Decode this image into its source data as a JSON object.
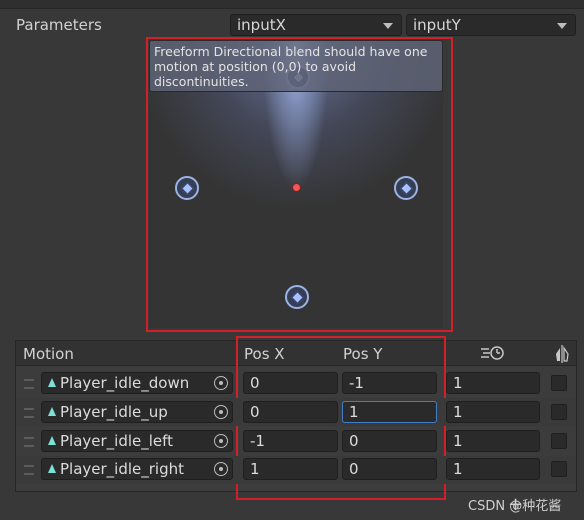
{
  "parameters": {
    "label": "Parameters",
    "param_x": "inputX",
    "param_y": "inputY"
  },
  "blend_tree": {
    "warning": "Freeform Directional blend should have one motion at position (0,0) to avoid discontinuities."
  },
  "table": {
    "headers": {
      "motion": "Motion",
      "pos_x": "Pos X",
      "pos_y": "Pos Y",
      "speed_icon": "time-scale-icon",
      "mirror_icon": "mirror-icon"
    },
    "rows": [
      {
        "motion": "Player_idle_down",
        "pos_x": "0",
        "pos_y": "-1",
        "speed": "1",
        "mirror": false
      },
      {
        "motion": "Player_idle_up",
        "pos_x": "0",
        "pos_y": "1",
        "speed": "1",
        "mirror": false
      },
      {
        "motion": "Player_idle_left",
        "pos_x": "-1",
        "pos_y": "0",
        "speed": "1",
        "mirror": false
      },
      {
        "motion": "Player_idle_right",
        "pos_x": "1",
        "pos_y": "0",
        "speed": "1",
        "mirror": false
      }
    ]
  },
  "watermark": "CSDN @种花酱",
  "colors": {
    "highlight_box": "#d12027",
    "center_point": "#f25757",
    "motion_node": "#9db3e6",
    "focus_border": "#3e7fc8"
  }
}
